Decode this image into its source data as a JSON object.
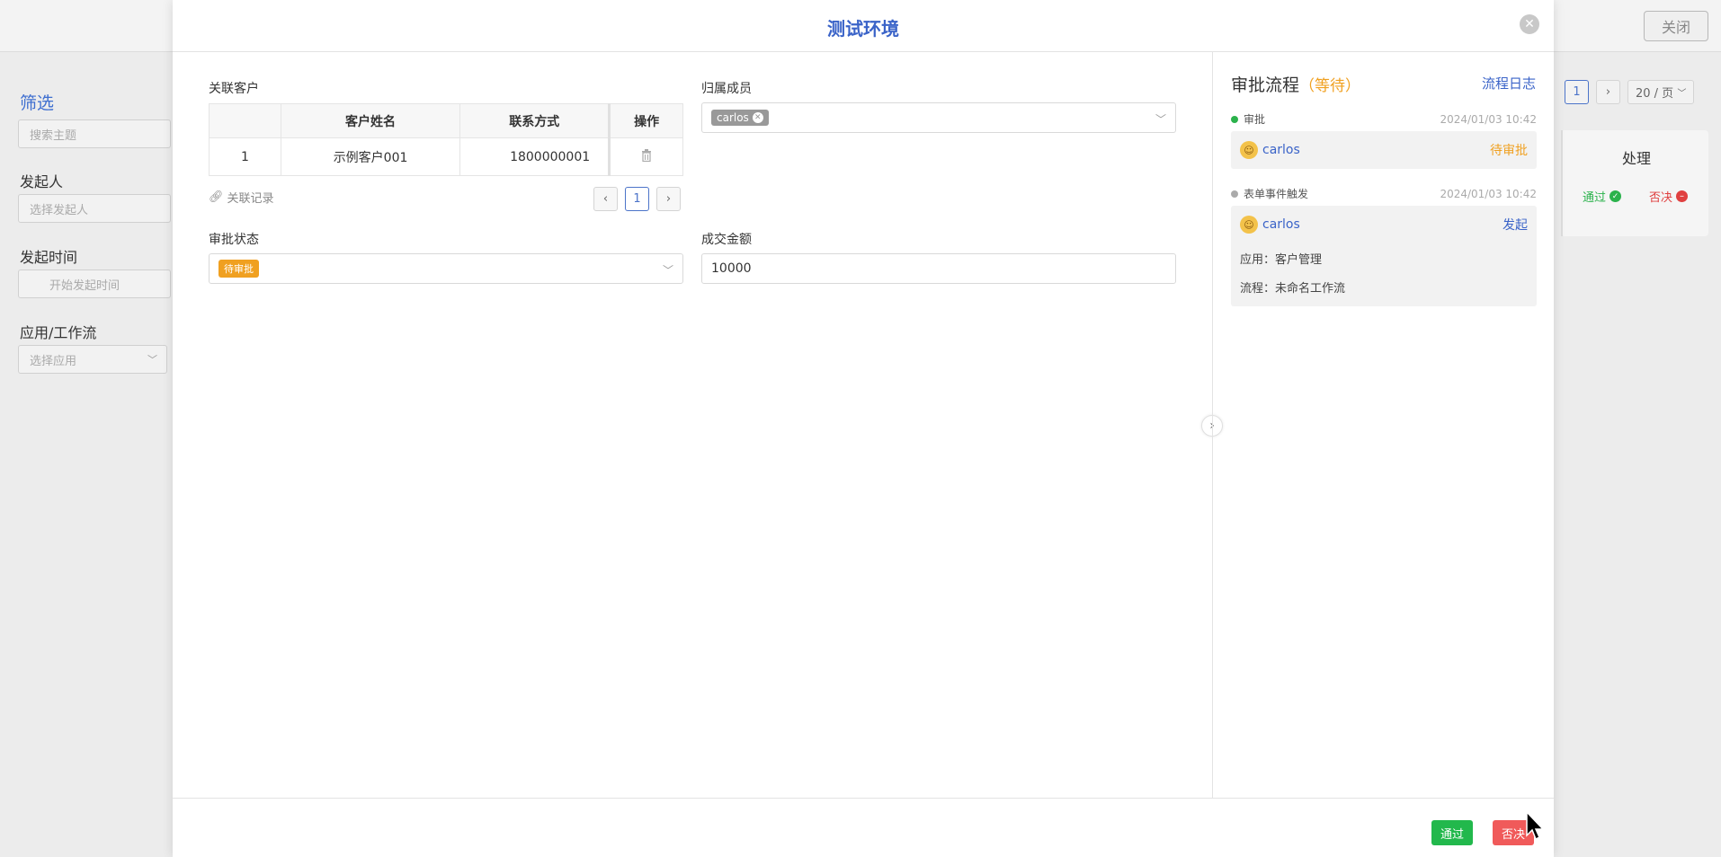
{
  "background": {
    "close_label": "关闭",
    "filter_title": "筛选",
    "search_placeholder": "搜索主题",
    "initiator_label": "发起人",
    "initiator_placeholder": "选择发起人",
    "time_label": "发起时间",
    "time_placeholder": "开始发起时间",
    "app_label": "应用/工作流",
    "app_placeholder": "选择应用",
    "pager_page": "1",
    "page_size": "20 / 页",
    "card_title": "处理",
    "approve_label": "通过",
    "reject_label": "否决"
  },
  "modal": {
    "title": "测试环境",
    "customer_label": "关联客户",
    "table": {
      "headers": [
        "",
        "客户姓名",
        "联系方式",
        "操作"
      ],
      "rows": [
        {
          "index": "1",
          "name": "示例客户001",
          "phone": "1800000001"
        }
      ]
    },
    "link_records": "关联记录",
    "pager_page": "1",
    "member_label": "归属成员",
    "member_tag": "carlos",
    "status_label": "审批状态",
    "status_tag": "待审批",
    "amount_label": "成交金额",
    "amount_value": "10000"
  },
  "panel": {
    "title": "审批流程",
    "title_status": "（等待）",
    "log_link": "流程日志",
    "steps": [
      {
        "name": "审批",
        "time": "2024/01/03 10:42",
        "dot_color": "#2bb24c",
        "user": "carlos",
        "status": "待审批",
        "status_color": "#f0a020"
      },
      {
        "name": "表单事件触发",
        "time": "2024/01/03 10:42",
        "dot_color": "#aaaaaa",
        "user": "carlos",
        "status": "发起",
        "status_color": "#3a63c8",
        "app_label": "应用：",
        "app_value": "客户管理",
        "flow_label": "流程：",
        "flow_value": "未命名工作流"
      }
    ]
  },
  "footer": {
    "approve": "通过",
    "reject": "否决",
    "approve_color": "#22b84c",
    "reject_color": "#f05a5a"
  }
}
